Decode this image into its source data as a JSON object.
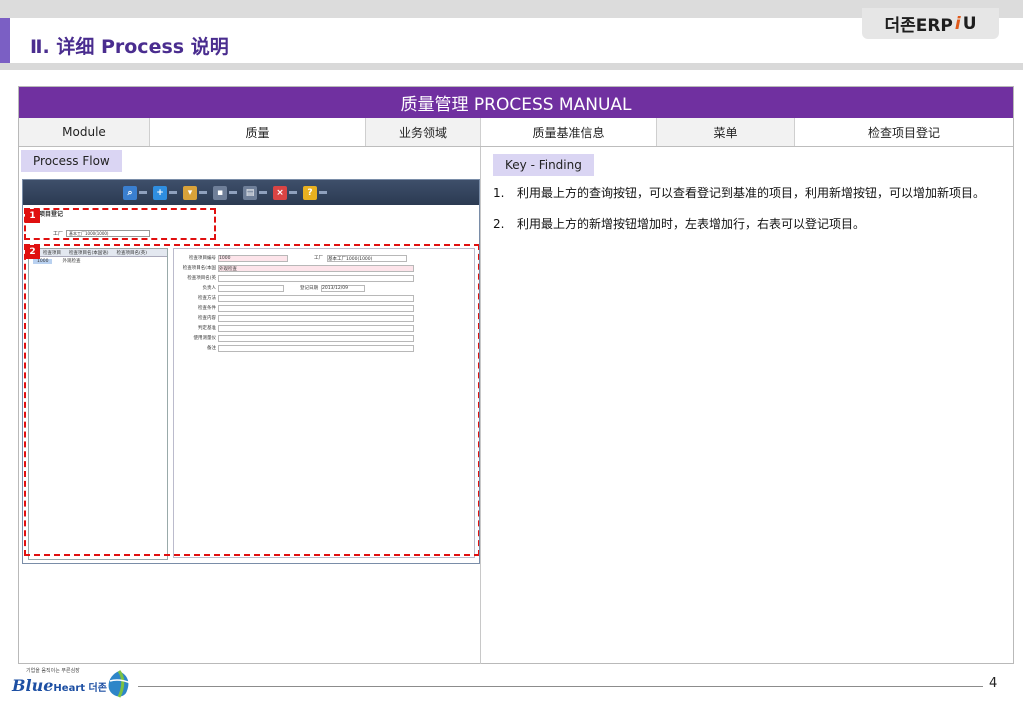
{
  "header": {
    "section_title": "Ⅱ. 详细 Process 说明",
    "brand_prefix": "더존ERP",
    "brand_slash": "i",
    "brand_suffix": "U"
  },
  "banner": {
    "title": "质量管理 PROCESS MANUAL"
  },
  "meta": [
    {
      "label": "Module"
    },
    {
      "value": "质量"
    },
    {
      "label": "业务领域"
    },
    {
      "value": "质量基准信息"
    },
    {
      "label": "菜单"
    },
    {
      "value": "检查项目登记"
    }
  ],
  "left": {
    "tag": "Process Flow",
    "screenshot": {
      "toolbar": [
        "检索",
        "新增",
        "删除",
        "保存",
        "打印",
        "关闭",
        "帮助"
      ],
      "window_title": "检查项目登记",
      "plant_label": "工厂",
      "plant_value": "基本工厂1000(1000)",
      "grid_headers": [
        "检查项目",
        "检查项目名(本国语)",
        "检查项目名(英)"
      ],
      "grid_rows": [
        {
          "code": "1000",
          "name": "外观检查"
        }
      ],
      "form": {
        "code_label": "检查项目编号",
        "code_value": "1000",
        "plant_label": "工厂",
        "plant_value": "基本工厂1000(1000)",
        "name_label": "检查项目名(本国",
        "name_value": "外观检查",
        "name_en_label": "检查项目名(英",
        "owner_label": "负责人",
        "date_label": "登记日期",
        "date_value": "2013/12/09",
        "method_label": "检查方法",
        "condition_label": "检查条件",
        "content_label": "检查内容",
        "criteria_label": "判定基准",
        "device_label": "使用测量仪",
        "remark_label": "备注"
      },
      "markers": [
        "1",
        "2"
      ]
    }
  },
  "right": {
    "tag": "Key - Finding",
    "notes": [
      {
        "num": "1.",
        "text": "利用最上方的查询按钮，可以查看登记到基准的项目，利用新增按钮，可以增加新项目。"
      },
      {
        "num": "2.",
        "text": "利用最上方的新增按钮增加时，左表增加行，右表可以登记项目。"
      }
    ]
  },
  "footer": {
    "logo_tagline": "기업을 움직이는 푸른심장",
    "logo_main": "Blue",
    "logo_heart": "Heart 더존",
    "page_number": "4"
  },
  "colors": {
    "banner": "#7030a0",
    "accent": "#7b5fc4",
    "tag_bg": "#dad5f3",
    "marker": "#e01010"
  }
}
